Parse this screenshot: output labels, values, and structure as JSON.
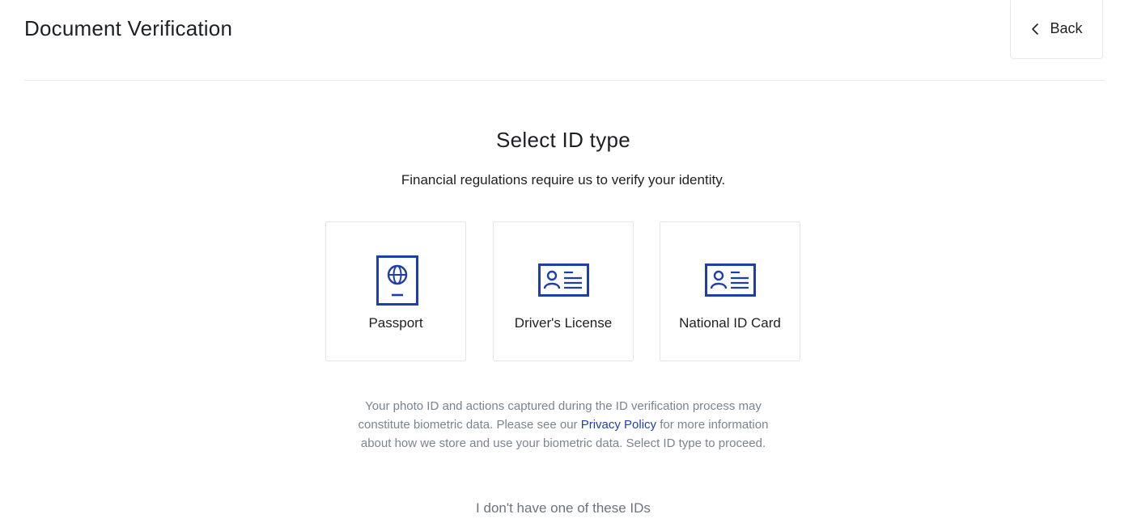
{
  "header": {
    "title": "Document Verification",
    "back_label": "Back"
  },
  "main": {
    "heading": "Select ID type",
    "subheading": "Financial regulations require us to verify your identity.",
    "id_types": [
      {
        "label": "Passport",
        "icon": "passport-icon"
      },
      {
        "label": "Driver's License",
        "icon": "id-card-icon"
      },
      {
        "label": "National ID Card",
        "icon": "id-card-icon"
      }
    ],
    "disclaimer": {
      "text_before": "Your photo ID and actions captured during the ID verification process may constitute biometric data. Please see our ",
      "link_text": "Privacy Policy",
      "text_after": " for more information about how we store and use your biometric data. Select ID type to proceed."
    },
    "no_id_link": "I don't have one of these IDs"
  },
  "colors": {
    "icon_blue": "#1f3fa8",
    "link_blue": "#1f3fa8",
    "muted_text": "#7a8491",
    "border": "#e3e6ea"
  }
}
